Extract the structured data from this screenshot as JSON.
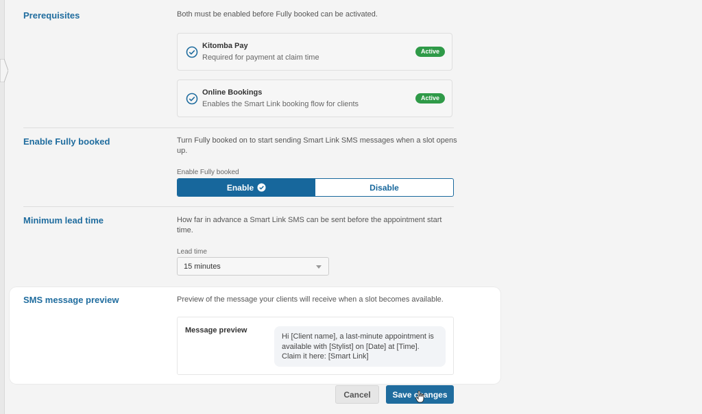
{
  "prerequisites": {
    "heading": "Prerequisites",
    "description": "Both must be enabled before Fully booked can be activated.",
    "items": [
      {
        "title": "Kitomba Pay",
        "subtitle": "Required for payment at claim time",
        "status": "Active"
      },
      {
        "title": "Online Bookings",
        "subtitle": "Enables the Smart Link booking flow for clients",
        "status": "Active"
      }
    ]
  },
  "enable": {
    "heading": "Enable Fully booked",
    "description": "Turn Fully booked on to start sending Smart Link SMS messages when a slot opens up.",
    "field_label": "Enable Fully booked",
    "options": [
      "Enable",
      "Disable"
    ],
    "selected": "Enable"
  },
  "lead_time": {
    "heading": "Minimum lead time",
    "description": "How far in advance a Smart Link SMS can be sent before the appointment start time.",
    "field_label": "Lead time",
    "value": "15 minutes"
  },
  "sms_preview": {
    "heading": "SMS message preview",
    "description": "Preview of the message your clients will receive when a slot becomes available.",
    "label": "Message preview",
    "message": "Hi [Client name], a last-minute appointment is available with [Stylist] on [Date] at [Time]. Claim it here: [Smart Link]"
  },
  "actions": {
    "cancel": "Cancel",
    "save": "Save changes"
  },
  "colors": {
    "accent": "#1f6c9e",
    "active_badge": "#2f9a48"
  },
  "icons": {
    "prereq_check": "check-circle-icon",
    "enable_check": "check-badge-icon",
    "select_caret": "chevron-down-icon"
  }
}
